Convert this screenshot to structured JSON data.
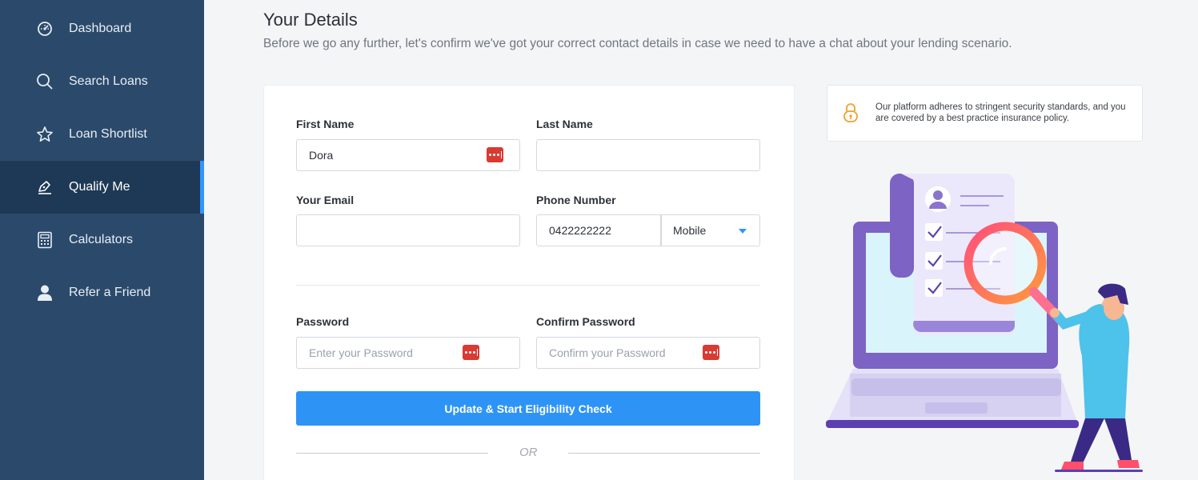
{
  "sidebar": {
    "items": [
      {
        "label": "Dashboard",
        "icon": "dashboard-gauge-icon",
        "active": false
      },
      {
        "label": "Search Loans",
        "icon": "search-icon",
        "active": false
      },
      {
        "label": "Loan Shortlist",
        "icon": "star-icon",
        "active": false
      },
      {
        "label": "Qualify Me",
        "icon": "pen-icon",
        "active": true
      },
      {
        "label": "Calculators",
        "icon": "calculator-icon",
        "active": false
      },
      {
        "label": "Refer a Friend",
        "icon": "user-icon",
        "active": false
      }
    ]
  },
  "header": {
    "title": "Your Details",
    "subtitle": "Before we go any further, let's confirm we've got your correct contact details in case we need to have a chat about your lending scenario."
  },
  "form": {
    "first_name": {
      "label": "First Name",
      "value": "Dora"
    },
    "last_name": {
      "label": "Last Name",
      "value": ""
    },
    "email": {
      "label": "Your Email",
      "value": ""
    },
    "phone": {
      "label": "Phone Number",
      "value": "0422222222",
      "type_selected": "Mobile"
    },
    "password": {
      "label": "Password",
      "placeholder": "Enter your Password"
    },
    "confirm_password": {
      "label": "Confirm Password",
      "placeholder": "Confirm your Password"
    },
    "submit_label": "Update & Start Eligibility Check",
    "or_text": "OR"
  },
  "security_note": {
    "icon": "padlock-icon",
    "text": "Our platform adheres to stringent security standards, and you are covered by a best practice insurance policy."
  },
  "colors": {
    "sidebar_bg": "#2b4a6b",
    "sidebar_active_bg": "#1e3955",
    "accent": "#2f95ff",
    "button": "#2d94f5",
    "password_badge": "#d93a32"
  }
}
